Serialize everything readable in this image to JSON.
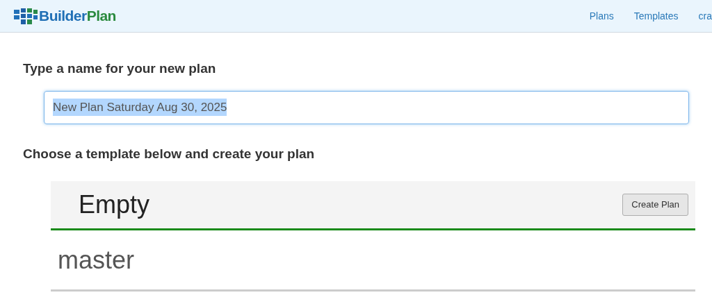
{
  "header": {
    "logo": {
      "first": "Builder",
      "second": "Plan"
    },
    "nav": [
      {
        "label": "Plans"
      },
      {
        "label": "Templates"
      },
      {
        "label": "cra"
      }
    ]
  },
  "name_section": {
    "heading": "Type a name for your new plan",
    "field": {
      "value": "New Plan Saturday Aug 30, 2025",
      "text_selected": true,
      "focused": true
    }
  },
  "template_section": {
    "heading": "Choose a template below and create your plan",
    "templates": [
      {
        "name": "Empty",
        "selected": true,
        "button": "Create Plan"
      },
      {
        "name": "master",
        "selected": false
      }
    ]
  }
}
